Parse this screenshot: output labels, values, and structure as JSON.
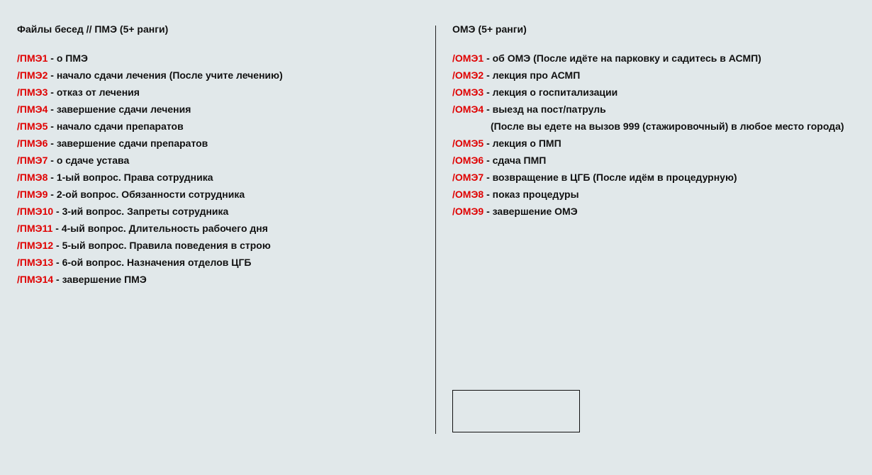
{
  "left": {
    "title": "Файлы бесед // ПМЭ (5+ ранги)",
    "items": [
      {
        "cmd": "/ПМЭ1",
        "text": " - о ПМЭ"
      },
      {
        "cmd": "/ПМЭ2",
        "text": " - начало сдачи лечения (После учите лечению)"
      },
      {
        "cmd": "/ПМЭ3",
        "text": " - отказ от лечения"
      },
      {
        "cmd": "/ПМЭ4",
        "text": " - завершение сдачи лечения"
      },
      {
        "cmd": "/ПМЭ5",
        "text": " - начало сдачи препаратов"
      },
      {
        "cmd": "/ПМЭ6",
        "text": " - завершение сдачи препаратов"
      },
      {
        "cmd": "/ПМЭ7",
        "text": " - о сдаче устава"
      },
      {
        "cmd": "/ПМЭ8",
        "text": " - 1-ый вопрос. Права сотрудника"
      },
      {
        "cmd": "/ПМЭ9",
        "text": " - 2-ой вопрос. Обязанности сотрудника"
      },
      {
        "cmd": "/ПМЭ10",
        "text": " - 3-ий вопрос. Запреты сотрудника"
      },
      {
        "cmd": "/ПМЭ11",
        "text": " - 4-ый вопрос. Длительность рабочего дня"
      },
      {
        "cmd": "/ПМЭ12",
        "text": " - 5-ый вопрос. Правила поведения в строю"
      },
      {
        "cmd": "/ПМЭ13",
        "text": " - 6-ой вопрос. Назначения отделов ЦГБ"
      },
      {
        "cmd": "/ПМЭ14",
        "text": " - завершение ПМЭ"
      }
    ]
  },
  "right": {
    "title": "ОМЭ (5+ ранги)",
    "items": [
      {
        "cmd": "/ОМЭ1",
        "text": " - об ОМЭ (После идёте на парковку и садитесь в АСМП)"
      },
      {
        "cmd": "/ОМЭ2",
        "text": " - лекция про АСМП"
      },
      {
        "cmd": "/ОМЭ3",
        "text": " - лекция о госпитализации"
      },
      {
        "cmd": "/ОМЭ4",
        "text": " - выезд на пост/патруль"
      },
      {
        "cmd": "",
        "text": "(После вы едете на вызов 999 (стажировочный) в любое место города)"
      },
      {
        "cmd": "/ОМЭ5",
        "text": " - лекция о ПМП"
      },
      {
        "cmd": "/ОМЭ6",
        "text": " - сдача ПМП"
      },
      {
        "cmd": "/ОМЭ7",
        "text": " - возвращение в ЦГБ (После идём в процедурную)"
      },
      {
        "cmd": "/ОМЭ8",
        "text": " - показ процедуры"
      },
      {
        "cmd": "/ОМЭ9",
        "text": " - завершение ОМЭ"
      }
    ]
  },
  "colors": {
    "background": "#e1e8ea",
    "command": "#e00000",
    "text": "#111111"
  }
}
